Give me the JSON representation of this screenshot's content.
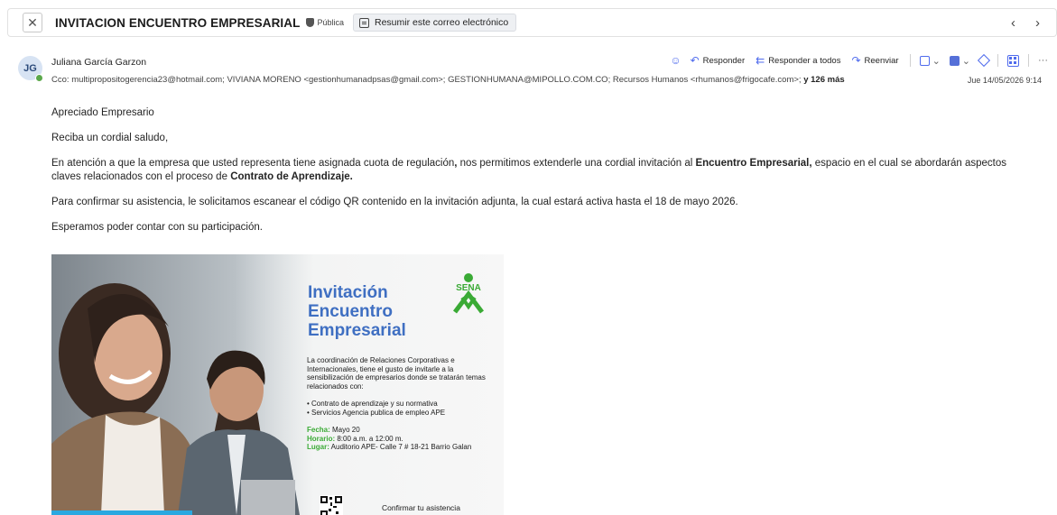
{
  "header": {
    "subject": "INVITACION ENCUENTRO EMPRESARIAL",
    "visibility": "Pública",
    "summarize_label": "Resumir este correo electrónico",
    "prev_arrow": "‹",
    "next_arrow": "›"
  },
  "sender": {
    "initials": "JG",
    "name": "Juliana García Garzon",
    "cc_prefix": "Cco:",
    "cc_list": "multipropositogerencia23@hotmail.com;  VIVIANA MORENO <gestionhumanadpsas@gmail.com>;  GESTIONHUMANA@MIPOLLO.COM.CO;  Recursos Humanos <rhumanos@frigocafe.com>;",
    "cc_more": "y 126 más",
    "datetime": "Jue 14/05/2026 9:14"
  },
  "actions": {
    "reply": "Responder",
    "reply_all": "Responder a todos",
    "forward": "Reenviar",
    "more": "···"
  },
  "body": {
    "greeting": "Apreciado Empresario",
    "salute": "Reciba un cordial saludo,",
    "p1_a": "En atención a que la empresa que usted representa tiene asignada cuota de regulación",
    "p1_comma": ",",
    "p1_b": " nos permitimos extenderle una cordial invitación al ",
    "p1_bold1": "Encuentro Empresarial,",
    "p1_c": " espacio en el cual se abordarán aspectos claves relacionados con el proceso de ",
    "p1_bold2": "Contrato de Aprendizaje.",
    "p2": "Para confirmar su asistencia, le solicitamos escanear el código QR contenido en la invitación adjunta, la cual estará activa hasta el 18 de mayo 2026.",
    "p3": "Esperamos poder contar con su participación."
  },
  "invitation": {
    "title_l1": "Invitación",
    "title_l2": "Encuentro",
    "title_l3": "Empresarial",
    "logo_text": "SENA",
    "intro": "La coordinación de Relaciones Corporativas e Internacionales, tiene el gusto de invitarle a la sensibilización de empresarios donde se tratarán temas relacionados con:",
    "topic1": "• Contrato de aprendizaje y su normativa",
    "topic2": "• Servicios Agencia publica de empleo APE",
    "fecha_label": "Fecha:",
    "fecha": " Mayo 20",
    "horario_label": "Horario:",
    "horario": " 8:00 a.m. a 12:00 m.",
    "lugar_label": "Lugar:",
    "lugar": " Auditorio APE- Calle 7 # 18-21 Barrio Galan",
    "confirm": "Confirmar tu asistencia"
  },
  "colors": {
    "accent": "#4f6bed",
    "title_blue": "#3f6fc2",
    "sena_green": "#3aaa35",
    "presence_green": "#5ba84b"
  }
}
